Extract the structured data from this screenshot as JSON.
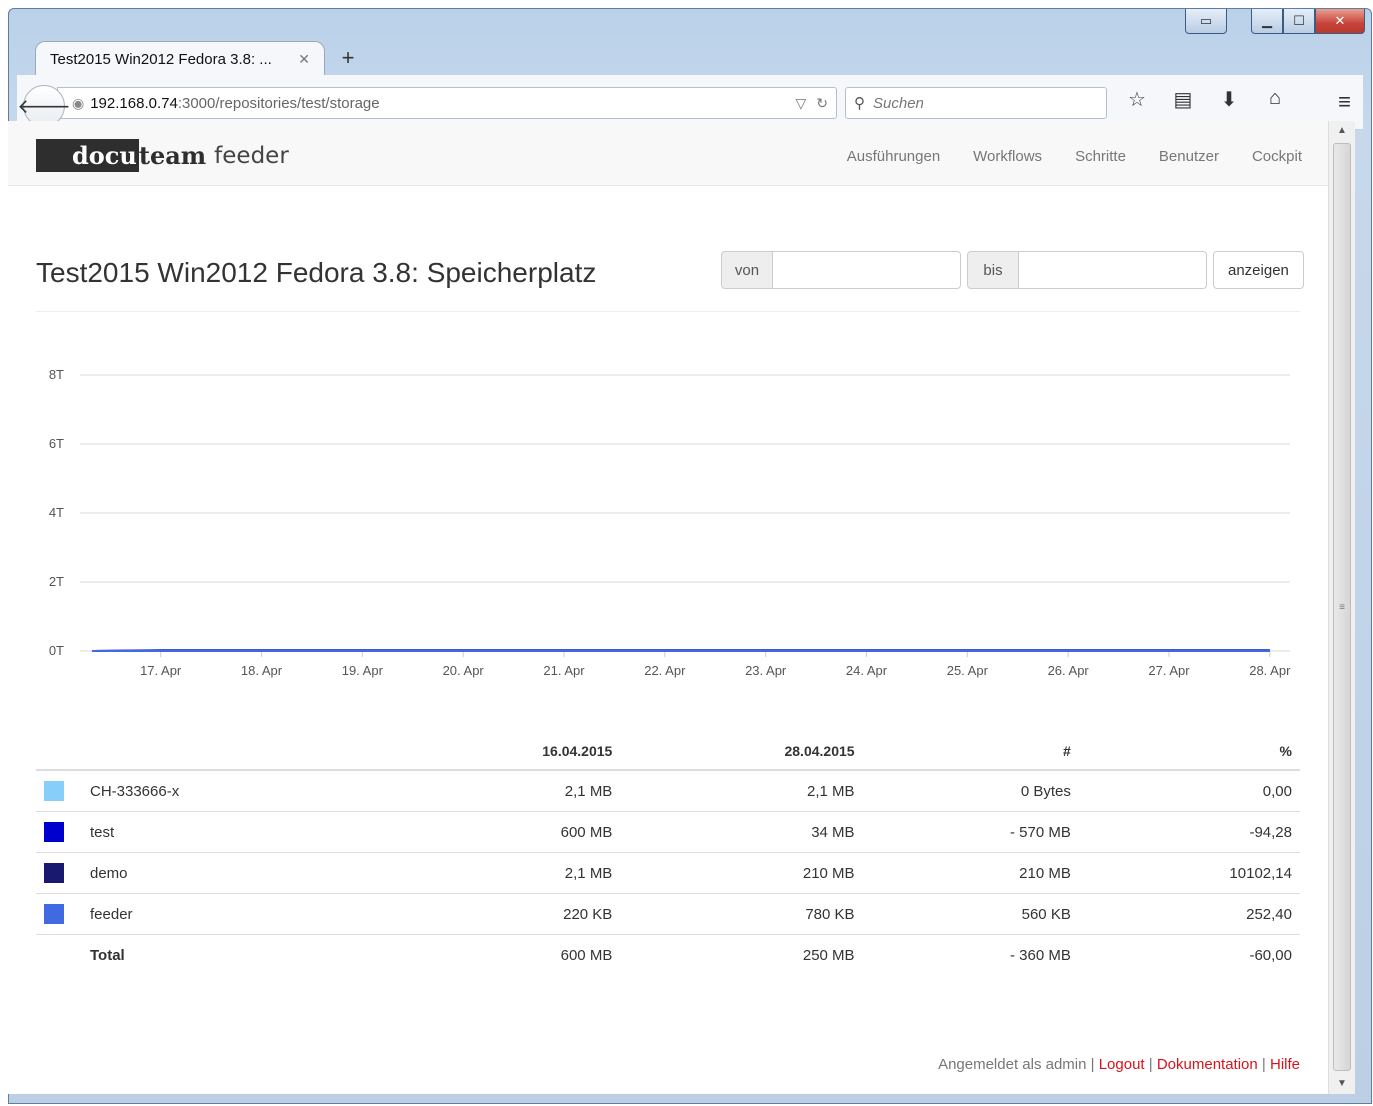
{
  "browser": {
    "tab_title": "Test2015 Win2012 Fedora 3.8: ...",
    "url_host": "192.168.0.74",
    "url_path": ":3000/repositories/test/storage",
    "search_placeholder": "Suchen"
  },
  "app": {
    "logo_box": "docu",
    "logo_team": "team",
    "logo_feeder": "feeder",
    "nav": [
      "Ausführungen",
      "Workflows",
      "Schritte",
      "Benutzer",
      "Cockpit"
    ]
  },
  "page": {
    "title": "Test2015 Win2012 Fedora 3.8: Speicherplatz",
    "from_label": "von",
    "to_label": "bis",
    "show_button": "anzeigen"
  },
  "chart_data": {
    "type": "area",
    "y_ticks": [
      "0T",
      "2T",
      "4T",
      "6T",
      "8T"
    ],
    "ylim": [
      0,
      8
    ],
    "x": [
      "17. Apr",
      "18. Apr",
      "19. Apr",
      "20. Apr",
      "21. Apr",
      "22. Apr",
      "23. Apr",
      "24. Apr",
      "25. Apr",
      "26. Apr",
      "27. Apr",
      "28. Apr"
    ],
    "grid": true,
    "series": [
      {
        "name": "CH-333666-x",
        "color": "#87cefa",
        "values": [
          0,
          0,
          0,
          0,
          0,
          0,
          0,
          0,
          0,
          0,
          0,
          0
        ]
      },
      {
        "name": "test",
        "color": "#0000cd",
        "values": [
          0,
          0,
          0,
          0,
          0,
          0,
          0,
          0,
          0,
          0,
          0,
          0
        ]
      },
      {
        "name": "demo",
        "color": "#191970",
        "values": [
          0,
          0,
          0,
          0,
          0,
          0,
          0,
          0,
          0,
          0,
          0,
          0
        ]
      },
      {
        "name": "feeder",
        "color": "#4169e1",
        "values": [
          0,
          0,
          0,
          0,
          0,
          0,
          0,
          0,
          0,
          0,
          0,
          0
        ]
      }
    ]
  },
  "table": {
    "headers": [
      "",
      "",
      "16.04.2015",
      "28.04.2015",
      "#",
      "%"
    ],
    "rows": [
      {
        "color": "#87cefa",
        "name": "CH-333666-x",
        "start": "2,1 MB",
        "end": "2,1 MB",
        "diff": "0 Bytes",
        "pct": "0,00"
      },
      {
        "color": "#0000cd",
        "name": "test",
        "start": "600 MB",
        "end": "34 MB",
        "diff": "- 570 MB",
        "pct": "-94,28"
      },
      {
        "color": "#191970",
        "name": "demo",
        "start": "2,1 MB",
        "end": "210 MB",
        "diff": "210 MB",
        "pct": "10102,14"
      },
      {
        "color": "#4169e1",
        "name": "feeder",
        "start": "220 KB",
        "end": "780 KB",
        "diff": "560 KB",
        "pct": "252,40"
      }
    ],
    "total": {
      "name": "Total",
      "start": "600 MB",
      "end": "250 MB",
      "diff": "- 360 MB",
      "pct": "-60,00"
    }
  },
  "footer": {
    "logged_in": "Angemeldet als admin",
    "logout": "Logout",
    "docs": "Dokumentation",
    "help": "Hilfe"
  }
}
